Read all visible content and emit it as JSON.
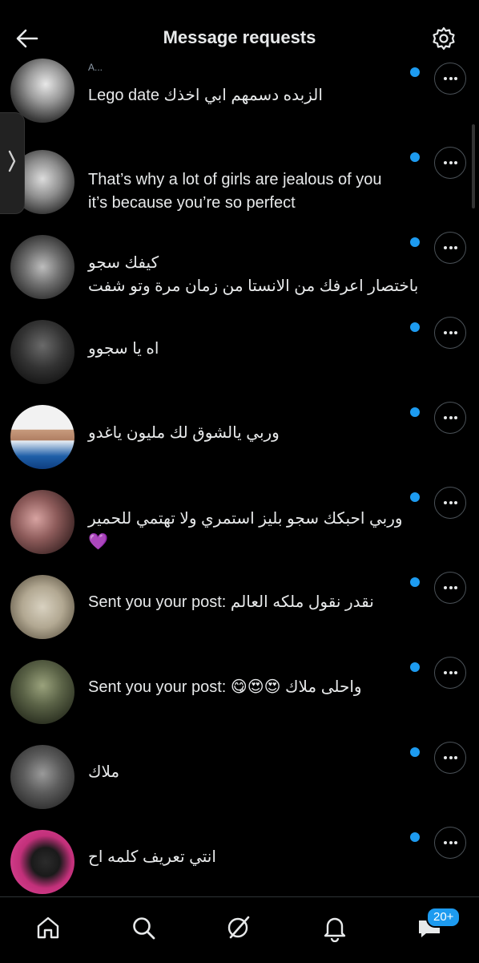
{
  "header": {
    "title": "Message requests"
  },
  "rows": [
    {
      "name": "A...",
      "message": "Lego date الزبده دسمهم ابي اخذك"
    },
    {
      "name": "",
      "message": "That’s why a lot of girls are jealous of you\nit’s because you’re so perfect"
    },
    {
      "name": "",
      "message": "كيفك سجو\nباختصار اعرفك من الانستا من زمان مرة وتو شفت"
    },
    {
      "name": "",
      "message": "اه يا سجوو"
    },
    {
      "name": "",
      "message": "وربي يالشوق لك مليون ياغدو"
    },
    {
      "name": "",
      "message": "وربي احبكك سجو بليز استمري ولا تهتمي للحمير\n💜"
    },
    {
      "name": "",
      "message": "Sent you your post: نقدر نقول ملكه العالم"
    },
    {
      "name": "",
      "message": "Sent you your post: 😋😍😍 واحلى ملاك"
    },
    {
      "name": "",
      "message": "ملاك"
    },
    {
      "name": "",
      "message": "انتي تعريف كلمه اح"
    }
  ],
  "bottom_nav": {
    "messages_badge": "20+"
  },
  "icons": {
    "back": "arrow-left-icon",
    "settings": "gear-icon",
    "more": "more-horizontal-icon",
    "nav": [
      "home-icon",
      "search-icon",
      "grok-icon",
      "bell-icon",
      "messages-icon"
    ]
  },
  "colors": {
    "accent": "#1d9bf0",
    "background": "#000000",
    "text": "#e7e9ea"
  }
}
